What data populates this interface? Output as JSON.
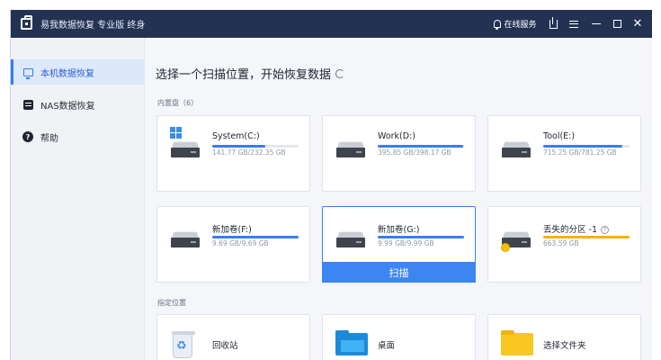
{
  "titlebar": {
    "title": "易我数据恢复 专业版 终身",
    "support_label": "在线服务",
    "close_symbol": "✕"
  },
  "sidebar": {
    "items": [
      {
        "label": "本机数据恢复",
        "icon": "monitor-icon",
        "active": true
      },
      {
        "label": "NAS数据恢复",
        "icon": "nas-icon",
        "active": false
      },
      {
        "label": "帮助",
        "icon": "help-icon",
        "active": false
      }
    ],
    "help_glyph": "?"
  },
  "main": {
    "title": "选择一个扫描位置，开始恢复数据",
    "internal_disks_label": "内置盘（6）",
    "specified_location_label": "指定位置",
    "scan_label": "扫描",
    "drives": [
      {
        "name": "System(C:)",
        "usage": "141.77 GB/232.35 GB",
        "fill": 0.61,
        "icon": "windows-drive-icon"
      },
      {
        "name": "Work(D:)",
        "usage": "395.85 GB/398.17 GB",
        "fill": 0.99,
        "icon": "hard-drive-icon"
      },
      {
        "name": "Tool(E:)",
        "usage": "715.25 GB/781.25 GB",
        "fill": 0.92,
        "icon": "hard-drive-icon"
      },
      {
        "name": "新加卷(F:)",
        "usage": "9.69 GB/9.69 GB",
        "fill": 1.0,
        "icon": "hard-drive-icon"
      },
      {
        "name": "新加卷(G:)",
        "usage": "9.99 GB/9.99 GB",
        "fill": 1.0,
        "icon": "hard-drive-icon",
        "selected": true
      },
      {
        "name": "丢失的分区 -1",
        "usage": "663.59 GB",
        "fill": 1.0,
        "icon": "lost-partition-icon",
        "help": "?"
      }
    ],
    "locations": [
      {
        "name": "回收站",
        "icon": "recycle-bin-icon"
      },
      {
        "name": "桌面",
        "icon": "desktop-folder-icon"
      },
      {
        "name": "选择文件夹",
        "icon": "folder-icon"
      }
    ]
  },
  "colors": {
    "titlebar_bg": "#233253",
    "accent": "#3b7cf0",
    "lost_partition_bar": "#f6b300"
  }
}
